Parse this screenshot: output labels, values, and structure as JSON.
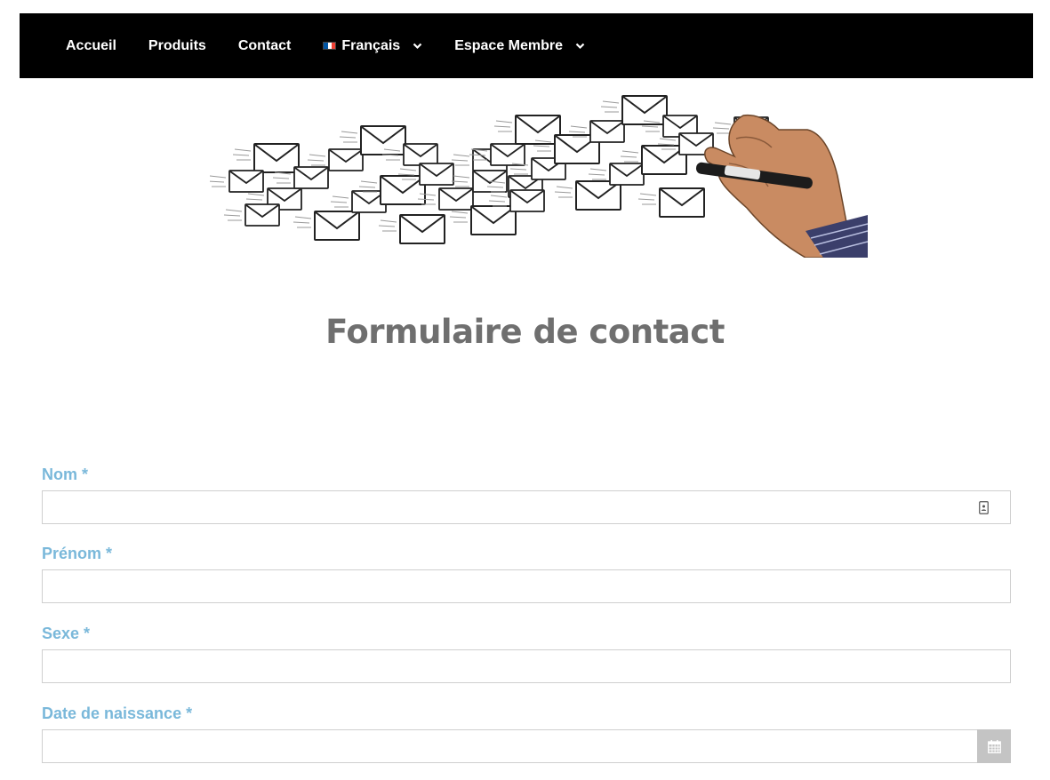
{
  "nav": {
    "items": [
      {
        "label": "Accueil"
      },
      {
        "label": "Produits"
      },
      {
        "label": "Contact"
      }
    ],
    "language": {
      "label": "Français",
      "flag_colors": [
        "#0055a4",
        "#ffffff",
        "#ef4135"
      ]
    },
    "member": {
      "label": "Espace Membre"
    }
  },
  "page": {
    "title": "Formulaire de contact"
  },
  "form": {
    "nom": {
      "label": "Nom *",
      "value": ""
    },
    "prenom": {
      "label": "Prénom *",
      "value": ""
    },
    "sexe": {
      "label": "Sexe *",
      "value": ""
    },
    "date_naissance": {
      "label": "Date de naissance *",
      "value": ""
    }
  },
  "colors": {
    "label": "#7ab8da",
    "title": "#6f6f6f",
    "nav_bg": "#000000"
  }
}
